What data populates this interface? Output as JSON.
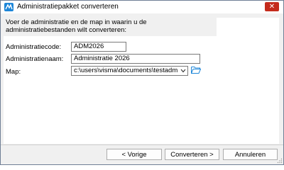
{
  "window": {
    "title": "Administratiepakket converteren",
    "close_glyph": "✕"
  },
  "intro": {
    "text": "Voer de administratie en de map in waarin u de administratiebestanden wilt converteren:"
  },
  "form": {
    "code_label": "Administratiecode:",
    "code_value": "ADM2026",
    "name_label": "Administratienaam:",
    "name_value": "Administratie 2026",
    "folder_label": "Map:",
    "folder_value": "c:\\users\\visma\\documents\\testadm"
  },
  "buttons": {
    "back": "< Vorige",
    "convert": "Converteren >",
    "cancel": "Annuleren"
  },
  "colors": {
    "accent": "#1d86d8",
    "close": "#c42b1c",
    "folder": "#1d86d8"
  },
  "icons": {
    "app": "app-logo-icon",
    "close": "close-icon",
    "dropdown": "chevron-down-icon",
    "browse": "folder-open-icon",
    "grip": "resize-grip-icon"
  }
}
